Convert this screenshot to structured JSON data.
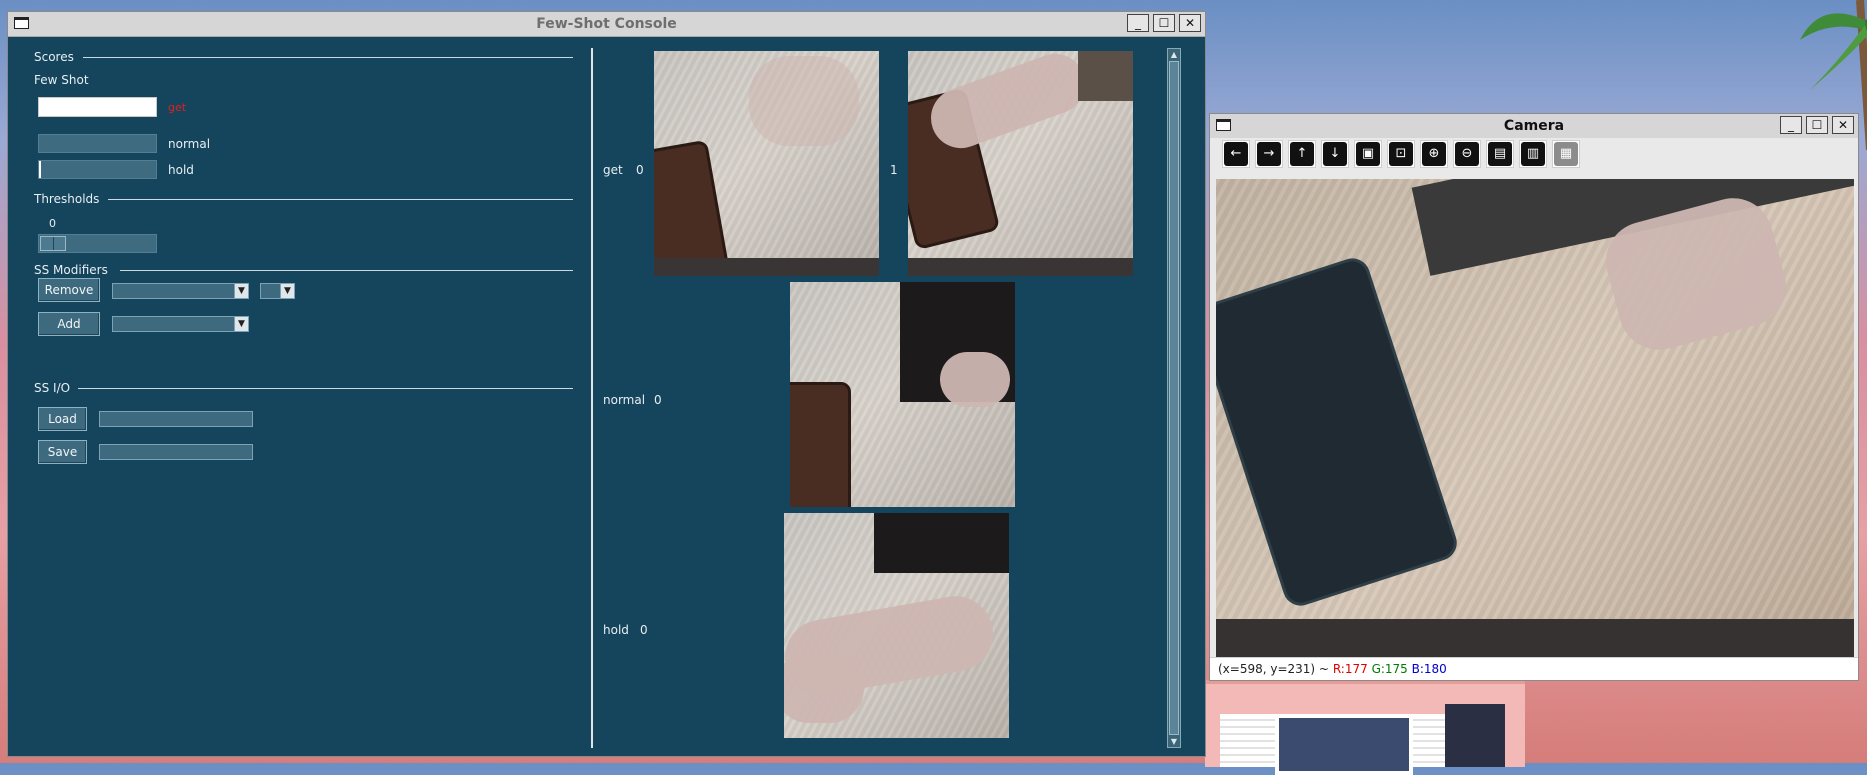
{
  "colors": {
    "panel_bg": "#15455c",
    "active_class": "#e02020",
    "status_red": "#e00000",
    "status_green": "#007a00",
    "status_blue": "#0000d0"
  },
  "console": {
    "title": "Few-Shot Console",
    "controls": {
      "minimize": "_",
      "maximize": "☐",
      "close": "✕"
    },
    "scores": {
      "section_label": "Scores",
      "sub_label": "Few Shot",
      "bars": [
        {
          "label": "get",
          "value": 1.0,
          "active": true
        },
        {
          "label": "normal",
          "value": 0.0,
          "active": false
        },
        {
          "label": "hold",
          "value": 0.02,
          "active": false
        }
      ]
    },
    "thresholds": {
      "section_label": "Thresholds",
      "slider_value": "0"
    },
    "ss_modifiers": {
      "section_label": "SS Modifiers",
      "remove_button": "Remove",
      "add_button": "Add"
    },
    "ss_io": {
      "section_label": "SS I/O",
      "load_button": "Load",
      "save_button": "Save",
      "load_path": "",
      "save_path": ""
    },
    "support_set": [
      {
        "class": "get",
        "counts": [
          "0",
          "1"
        ]
      },
      {
        "class": "normal",
        "counts": [
          "0"
        ]
      },
      {
        "class": "hold",
        "counts": [
          "0"
        ]
      }
    ]
  },
  "camera": {
    "title": "Camera",
    "controls": {
      "minimize": "_",
      "maximize": "☐",
      "close": "✕"
    },
    "tools": [
      {
        "icon": "arrow-left-icon",
        "glyph": "←"
      },
      {
        "icon": "arrow-right-icon",
        "glyph": "→"
      },
      {
        "icon": "arrow-up-icon",
        "glyph": "↑"
      },
      {
        "icon": "arrow-down-icon",
        "glyph": "↓"
      },
      {
        "icon": "image-icon",
        "glyph": "▣"
      },
      {
        "icon": "image-search-icon",
        "glyph": "⊡"
      },
      {
        "icon": "zoom-in-icon",
        "glyph": "⊕"
      },
      {
        "icon": "zoom-out-icon",
        "glyph": "⊖"
      },
      {
        "icon": "save-icon",
        "glyph": "▤"
      },
      {
        "icon": "clipboard-icon",
        "glyph": "▥"
      },
      {
        "icon": "save-disabled-icon",
        "glyph": "▦"
      }
    ],
    "status": {
      "coords": "(x=598, y=231) ~",
      "r": "R:177",
      "g": "G:175",
      "b": "B:180"
    }
  }
}
